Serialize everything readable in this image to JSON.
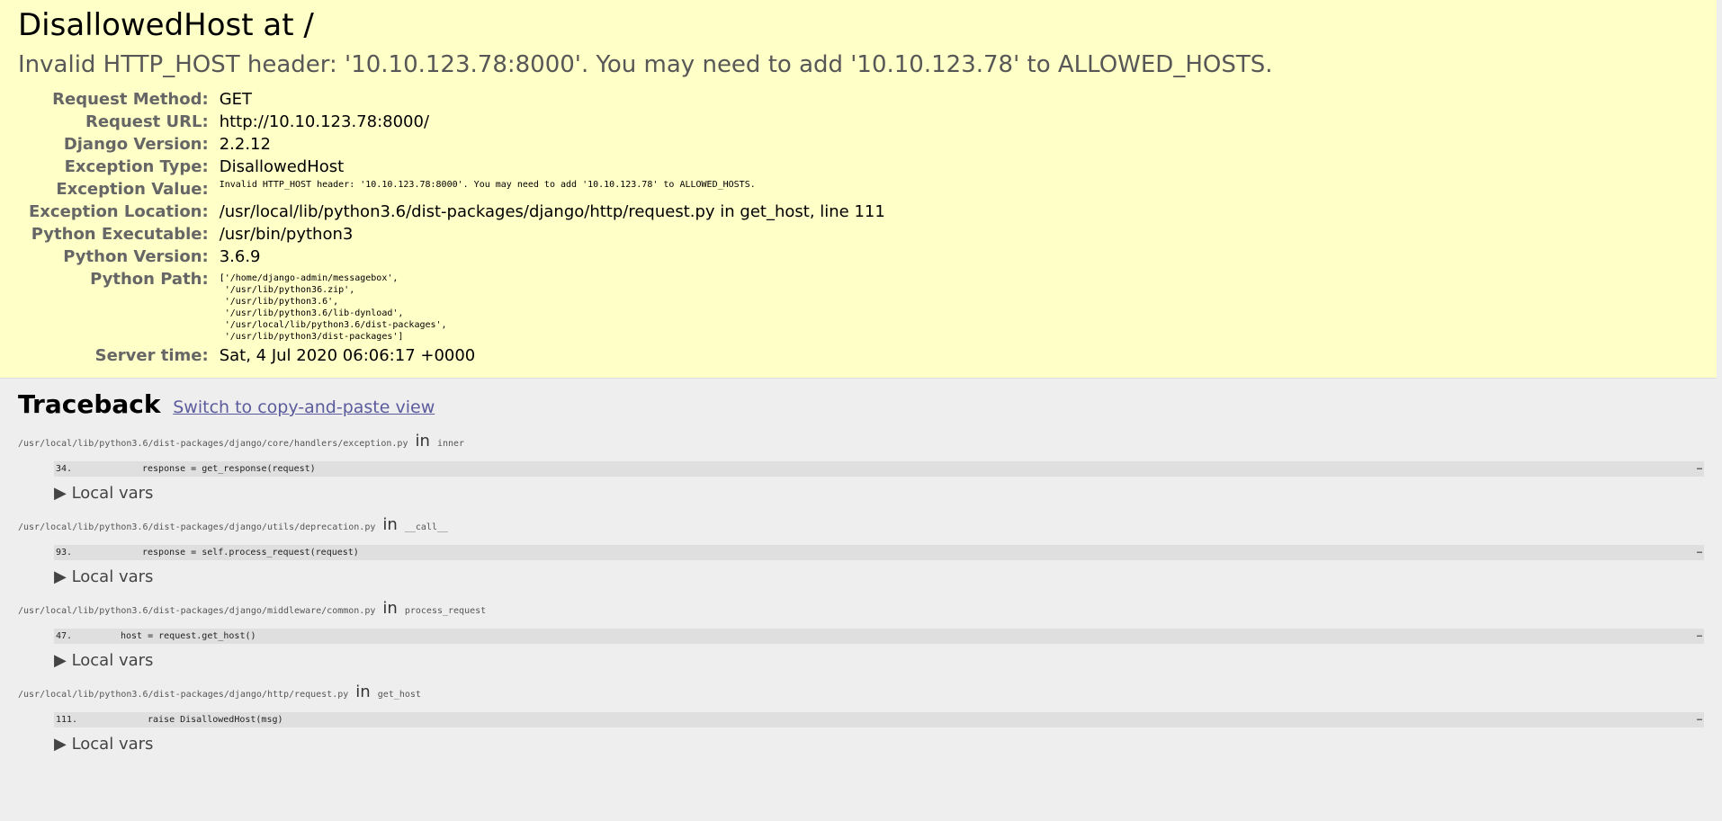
{
  "summary": {
    "title": "DisallowedHost at /",
    "message": "Invalid HTTP_HOST header: '10.10.123.78:8000'. You may need to add '10.10.123.78' to ALLOWED_HOSTS.",
    "rows": [
      {
        "label": "Request Method:",
        "value": "GET"
      },
      {
        "label": "Request URL:",
        "value": "http://10.10.123.78:8000/"
      },
      {
        "label": "Django Version:",
        "value": "2.2.12"
      },
      {
        "label": "Exception Type:",
        "value": "DisallowedHost"
      },
      {
        "label": "Exception Value:",
        "value": "Invalid HTTP_HOST header: '10.10.123.78:8000'. You may need to add '10.10.123.78' to ALLOWED_HOSTS."
      },
      {
        "label": "Exception Location:",
        "value": "/usr/local/lib/python3.6/dist-packages/django/http/request.py in get_host, line 111"
      },
      {
        "label": "Python Executable:",
        "value": "/usr/bin/python3"
      },
      {
        "label": "Python Version:",
        "value": "3.6.9"
      },
      {
        "label": "Python Path:",
        "value": "['/home/django-admin/messagebox',\n '/usr/lib/python36.zip',\n '/usr/lib/python3.6',\n '/usr/lib/python3.6/lib-dynload',\n '/usr/local/lib/python3.6/dist-packages',\n '/usr/lib/python3/dist-packages']"
      },
      {
        "label": "Server time:",
        "value": "Sat, 4 Jul 2020 06:06:17 +0000"
      }
    ]
  },
  "traceback": {
    "heading": "Traceback",
    "toggle_label": "Switch to copy-and-paste view",
    "in_word": "in",
    "local_vars_label": "▶ Local vars",
    "ellipsis": "…",
    "frames": [
      {
        "file": "/usr/local/lib/python3.6/dist-packages/django/core/handlers/exception.py",
        "func": "inner",
        "lineno": "34.",
        "code": "response = get_response(request)"
      },
      {
        "file": "/usr/local/lib/python3.6/dist-packages/django/utils/deprecation.py",
        "func": "__call__",
        "lineno": "93.",
        "code": "response = self.process_request(request)"
      },
      {
        "file": "/usr/local/lib/python3.6/dist-packages/django/middleware/common.py",
        "func": "process_request",
        "lineno": "47.",
        "code": "host = request.get_host()"
      },
      {
        "file": "/usr/local/lib/python3.6/dist-packages/django/http/request.py",
        "func": "get_host",
        "lineno": "111.",
        "code": "raise DisallowedHost(msg)"
      }
    ]
  }
}
